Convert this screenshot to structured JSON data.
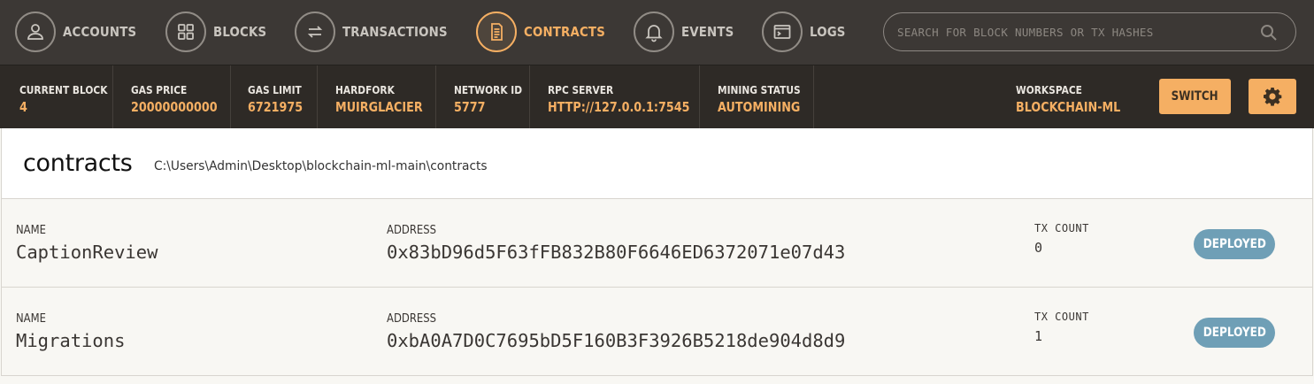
{
  "nav": {
    "items": [
      {
        "label": "ACCOUNTS",
        "icon": "user-icon"
      },
      {
        "label": "BLOCKS",
        "icon": "grid-icon"
      },
      {
        "label": "TRANSACTIONS",
        "icon": "swap-arrows-icon"
      },
      {
        "label": "CONTRACTS",
        "icon": "document-icon",
        "active": true
      },
      {
        "label": "EVENTS",
        "icon": "bell-icon"
      },
      {
        "label": "LOGS",
        "icon": "terminal-icon"
      }
    ],
    "search_placeholder": "SEARCH FOR BLOCK NUMBERS OR TX HASHES"
  },
  "status": {
    "current_block": {
      "label": "CURRENT BLOCK",
      "value": "4"
    },
    "gas_price": {
      "label": "GAS PRICE",
      "value": "20000000000"
    },
    "gas_limit": {
      "label": "GAS LIMIT",
      "value": "6721975"
    },
    "hardfork": {
      "label": "HARDFORK",
      "value": "MUIRGLACIER"
    },
    "network_id": {
      "label": "NETWORK ID",
      "value": "5777"
    },
    "rpc_server": {
      "label": "RPC SERVER",
      "value": "HTTP://127.0.0.1:7545"
    },
    "mining_status": {
      "label": "MINING STATUS",
      "value": "AUTOMINING"
    },
    "workspace": {
      "label": "WORKSPACE",
      "value": "BLOCKCHAIN-ML"
    },
    "switch_label": "SWITCH"
  },
  "page": {
    "title": "contracts",
    "path": "C:\\Users\\Admin\\Desktop\\blockchain-ml-main\\contracts"
  },
  "contracts": [
    {
      "name_label": "NAME",
      "name": "CaptionReview",
      "address_label": "ADDRESS",
      "address": "0x83bD96d5F63fFB832B80F6646ED6372071e07d43",
      "tx_label": "TX COUNT",
      "tx_count": "0",
      "status": "DEPLOYED"
    },
    {
      "name_label": "NAME",
      "name": "Migrations",
      "address_label": "ADDRESS",
      "address": "0xbA0A7D0C7695bD5F160B3F3926B5218de904d8d9",
      "tx_label": "TX COUNT",
      "tx_count": "1",
      "status": "DEPLOYED"
    }
  ],
  "colors": {
    "accent": "#f5af63",
    "nav_bg": "#3c3835",
    "status_bg": "#2e2a26",
    "badge": "#6f9fb6"
  }
}
